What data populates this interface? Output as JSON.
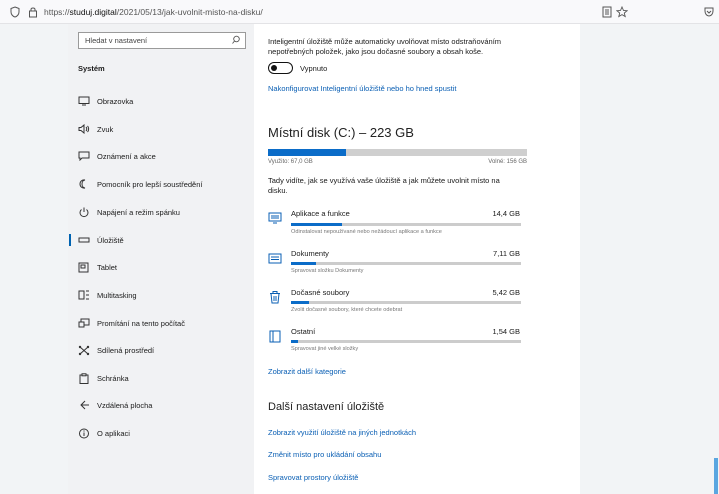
{
  "browser": {
    "url_scheme": "https://",
    "url_host": "studuj.digital",
    "url_path": "/2021/05/13/jak-uvolnit-misto-na-disku/"
  },
  "sidebar": {
    "search_placeholder": "Hledat v nastavení",
    "section_title": "Systém",
    "items": [
      {
        "label": "Obrazovka",
        "icon": "monitor-icon"
      },
      {
        "label": "Zvuk",
        "icon": "speaker-icon"
      },
      {
        "label": "Oznámení a akce",
        "icon": "notification-icon"
      },
      {
        "label": "Pomocník pro lepší soustředění",
        "icon": "moon-icon"
      },
      {
        "label": "Napájení a režim spánku",
        "icon": "power-icon"
      },
      {
        "label": "Úložiště",
        "icon": "storage-icon",
        "active": true
      },
      {
        "label": "Tablet",
        "icon": "tablet-icon"
      },
      {
        "label": "Multitasking",
        "icon": "multitasking-icon"
      },
      {
        "label": "Promítání na tento počítač",
        "icon": "projecting-icon"
      },
      {
        "label": "Sdílená prostředí",
        "icon": "shared-icon"
      },
      {
        "label": "Schránka",
        "icon": "clipboard-icon"
      },
      {
        "label": "Vzdálená plocha",
        "icon": "remote-icon"
      },
      {
        "label": "O aplikaci",
        "icon": "info-icon"
      }
    ]
  },
  "main": {
    "intro_line1": "Inteligentní úložiště může automaticky uvolňovat místo odstraňováním",
    "intro_line2": "nepotřebných položek, jako jsou dočasné soubory a obsah koše.",
    "toggle_label": "Vypnuto",
    "toggle_on": false,
    "configure_link": "Nakonfigurovat Inteligentní úložiště nebo ho hned spustit",
    "disk_title": "Místní disk (C:) – 223 GB",
    "disk_used_label": "Využito: 67,0 GB",
    "disk_free_label": "Volné: 156 GB",
    "disk_used_fraction": 0.3,
    "desc_line1": "Tady vidíte, jak se využívá vaše úložiště a jak můžete uvolnit místo na",
    "desc_line2": "disku.",
    "categories": [
      {
        "name": "Aplikace a funkce",
        "size": "14,4 GB",
        "desc": "Odinstalovat nepoužívané nebo nežádoucí aplikace a funkce",
        "fraction": 0.22,
        "icon": "apps-icon"
      },
      {
        "name": "Dokumenty",
        "size": "7,11 GB",
        "desc": "Spravovat složku Dokumenty",
        "fraction": 0.11,
        "icon": "documents-icon"
      },
      {
        "name": "Dočasné soubory",
        "size": "5,42 GB",
        "desc": "Zvolit dočasné soubory, které chcete odebrat",
        "fraction": 0.08,
        "icon": "trash-icon"
      },
      {
        "name": "Ostatní",
        "size": "1,54 GB",
        "desc": "Spravovat jiné velké složky",
        "fraction": 0.03,
        "icon": "other-icon"
      }
    ],
    "more_categories_link": "Zobrazit další kategorie",
    "more_settings_title": "Další nastavení úložiště",
    "links": [
      "Zobrazit využití úložiště na jiných jednotkách",
      "Změnit místo pro ukládání obsahu",
      "Spravovat prostory úložiště"
    ]
  }
}
